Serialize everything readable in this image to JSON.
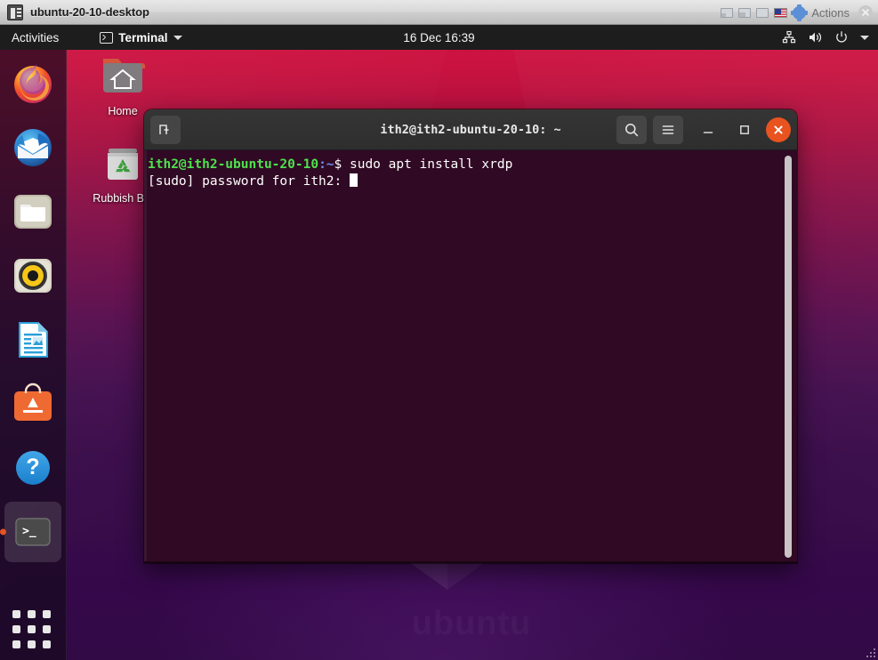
{
  "host_window": {
    "title": "ubuntu-20-10-desktop",
    "icon": "vm-screen-icon",
    "actions_label": "Actions",
    "status_icons": [
      "hard-disk-icon",
      "optical-disk-icon",
      "floppy-icon",
      "network-flag-icon",
      "settings-gear-icon"
    ],
    "close_icon": "close-icon"
  },
  "topbar": {
    "activities": "Activities",
    "app_menu": {
      "icon": "terminal-icon",
      "label": "Terminal",
      "caret": "chevron-down-icon"
    },
    "clock": "16 Dec  16:39",
    "tray": [
      "network-icon",
      "volume-icon",
      "power-icon",
      "chevron-down-icon"
    ]
  },
  "dock": {
    "items": [
      {
        "name": "firefox",
        "label": "Firefox Web Browser",
        "running": false
      },
      {
        "name": "thunderbird",
        "label": "Thunderbird Mail",
        "running": false
      },
      {
        "name": "files",
        "label": "Files",
        "running": false
      },
      {
        "name": "rhythmbox",
        "label": "Rhythmbox",
        "running": false
      },
      {
        "name": "libreoffice-writer",
        "label": "LibreOffice Writer",
        "running": false
      },
      {
        "name": "ubuntu-software",
        "label": "Ubuntu Software",
        "running": false
      },
      {
        "name": "help",
        "label": "Help",
        "running": false
      },
      {
        "name": "terminal",
        "label": "Terminal",
        "running": true
      }
    ],
    "show_apps_label": "Show Applications"
  },
  "desktop_icons": [
    {
      "name": "home",
      "label": "Home"
    },
    {
      "name": "rubbish-bin",
      "label": "Rubbish Bin"
    }
  ],
  "terminal": {
    "title": "ith2@ith2-ubuntu-20-10: ~",
    "new_tab_icon": "new-tab-icon",
    "search_icon": "search-icon",
    "menu_icon": "hamburger-menu-icon",
    "minimize_icon": "minimize-icon",
    "maximize_icon": "maximize-icon",
    "close_icon": "close-icon",
    "background_color": "#300a24",
    "lines": [
      {
        "segments": [
          {
            "text": "ith2@ith2-ubuntu-20-10",
            "color": "green"
          },
          {
            "text": ":~",
            "color": "blue"
          },
          {
            "text": "$ sudo apt install xrdp",
            "color": "white"
          }
        ]
      },
      {
        "segments": [
          {
            "text": "[sudo] password for ith2: ",
            "color": "white"
          }
        ],
        "cursor": true
      }
    ],
    "prompt_text": "ith2@ith2-ubuntu-20-10:~$ sudo apt install xrdp",
    "password_prompt": "[sudo] password for ith2: "
  },
  "wallpaper": {
    "watermark": "ubuntu"
  }
}
